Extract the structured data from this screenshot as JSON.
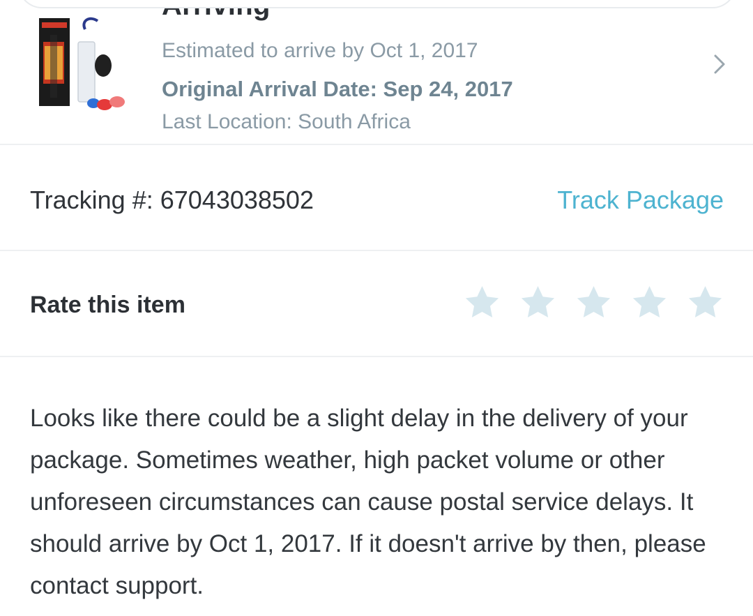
{
  "order": {
    "status": "Arriving",
    "estimated": "Estimated to arrive by Oct 1, 2017",
    "original_arrival": "Original Arrival Date: Sep 24, 2017",
    "last_location": "Last Location: South Africa",
    "chevron_icon": "chevron-right-icon"
  },
  "tracking": {
    "label": "Tracking #: 67043038502",
    "track_link": "Track Package"
  },
  "rating": {
    "label": "Rate this item",
    "max_stars": 5,
    "selected_stars": 0,
    "star_color": "#d6e7ee"
  },
  "notice": {
    "message": "Looks like there could be a slight delay in the delivery of your package. Sometimes weather, high packet volume or other unforeseen circumstances can cause postal service delays. It should arrive by Oct 1, 2017. If it doesn't arrive by then, please contact support."
  },
  "colors": {
    "link": "#4db3d0",
    "muted": "#8a9aa5"
  }
}
